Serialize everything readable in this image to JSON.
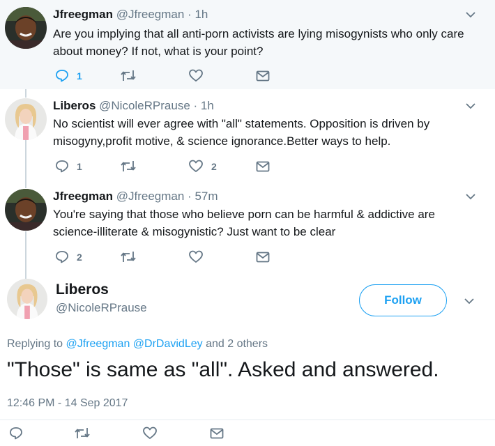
{
  "thread": [
    {
      "name": "Jfreegman",
      "handle": "@Jfreegman",
      "sep": "·",
      "time": "1h",
      "text": "Are you implying that all anti-porn activists are lying misogynists who only care about money? If not, what is your point?",
      "reply_count": "1",
      "retweet_count": "",
      "like_count": ""
    },
    {
      "name": "Liberos",
      "handle": "@NicoleRPrause",
      "sep": "·",
      "time": "1h",
      "text": "No scientist will ever agree with \"all\" statements. Opposition is driven by misogyny,profit motive, & science ignorance.Better ways to help.",
      "reply_count": "1",
      "retweet_count": "",
      "like_count": "2"
    },
    {
      "name": "Jfreegman",
      "handle": "@Jfreegman",
      "sep": "·",
      "time": "57m",
      "text": "You're saying that those who believe porn can be harmful & addictive are science-illiterate & misogynistic? Just want to be clear",
      "reply_count": "2",
      "retweet_count": "",
      "like_count": ""
    }
  ],
  "main_tweet": {
    "name": "Liberos",
    "handle": "@NicoleRPrause",
    "follow_label": "Follow",
    "replying_prefix": "Replying to",
    "replying_user1": "@Jfreegman",
    "replying_user2": "@DrDavidLey",
    "replying_suffix": "and 2 others",
    "text": "\"Those\" is same as \"all\". Asked and answered.",
    "timestamp": "12:46 PM - 14 Sep 2017"
  },
  "colors": {
    "accent": "#1da1f2",
    "muted": "#657786",
    "highlight_bg": "#f5f8fa",
    "thread_line": "#ccd6dd"
  },
  "icons": [
    "reply-icon",
    "retweet-icon",
    "like-icon",
    "direct-message-icon",
    "chevron-down-icon",
    "avatar"
  ]
}
